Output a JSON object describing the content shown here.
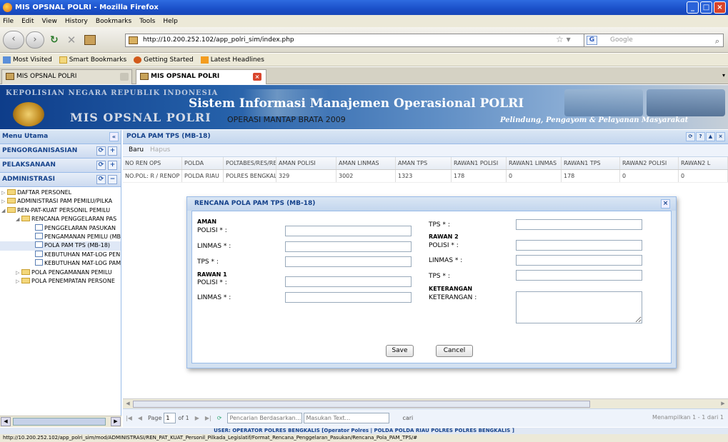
{
  "window": {
    "title": "MIS OPSNAL POLRI - Mozilla Firefox"
  },
  "menu": [
    "File",
    "Edit",
    "View",
    "History",
    "Bookmarks",
    "Tools",
    "Help"
  ],
  "nav": {
    "url": "http://10.200.252.102/app_polri_sim/index.php",
    "search_placeholder": "Google"
  },
  "bookmarks": [
    "Most Visited",
    "Smart Bookmarks",
    "Getting Started",
    "Latest Headlines"
  ],
  "tabs": [
    "MIS OPSNAL POLRI",
    "MIS OPSNAL POLRI"
  ],
  "banner": {
    "org": "KEPOLISIAN NEGARA REPUBLIK INDONESIA",
    "app": "MIS OPSNAL POLRI",
    "system": "Sistem Informasi Manajemen Operasional POLRI",
    "operation": "OPERASI MANTAP BRATA 2009",
    "motto": "Pelindung, Pengayom & Pelayanan Masyarakat"
  },
  "sidebar": {
    "title": "Menu Utama",
    "sections": [
      "PENGORGANISASIAN",
      "PELAKSANAAN",
      "ADMINISTRASI"
    ],
    "tree": [
      {
        "label": "DAFTAR PERSONEL",
        "type": "folder",
        "level": 0
      },
      {
        "label": "ADMINISTRASI PAM PEMILU/PILKA",
        "type": "folder",
        "level": 0
      },
      {
        "label": "REN-PAT-KUAT PERSONIL PEMILU",
        "type": "folder",
        "level": 0
      },
      {
        "label": "RENCANA PENGGELARAN PAS",
        "type": "folder",
        "level": 1
      },
      {
        "label": "PENGGELARAN PASUKAN",
        "type": "leaf",
        "level": 2
      },
      {
        "label": "PENGAMANAN PEMILU (MB",
        "type": "leaf",
        "level": 2
      },
      {
        "label": "POLA PAM TPS (MB-18)",
        "type": "leaf",
        "level": 2
      },
      {
        "label": "KEBUTUHAN MAT-LOG PEN",
        "type": "leaf",
        "level": 2
      },
      {
        "label": "KEBUTUHAN MAT-LOG PAM",
        "type": "leaf",
        "level": 2
      },
      {
        "label": "POLA PENGAMANAN PEMILU",
        "type": "folder",
        "level": 1
      },
      {
        "label": "POLA PENEMPATAN PERSONE",
        "type": "folder",
        "level": 1
      }
    ]
  },
  "main": {
    "title": "POLA PAM TPS (MB-18)",
    "toolbar": {
      "new": "Baru",
      "delete": "Hapus"
    },
    "columns": [
      "NO REN OPS",
      "POLDA",
      "POLTABES/RES/RE",
      "AMAN POLISI",
      "AMAN LINMAS",
      "AMAN TPS",
      "RAWAN1 POLISI",
      "RAWAN1 LINMAS",
      "RAWAN1 TPS",
      "RAWAN2 POLISI",
      "RAWAN2 L"
    ],
    "rows": [
      [
        "NO.POL: R / RENOP",
        "POLDA RIAU",
        "POLRES BENGKALI",
        "329",
        "3002",
        "1323",
        "178",
        "0",
        "178",
        "0",
        "0"
      ]
    ],
    "paging": {
      "page_label": "Page",
      "page": "1",
      "of": "of 1",
      "search_placeholder": "Pencarian Berdasarkan...",
      "text_placeholder": "Masukan Text...",
      "find": "cari",
      "info": "Menampilkan 1 - 1 dari 1"
    }
  },
  "dialog": {
    "title": "RENCANA POLA PAM TPS (MB-18)",
    "aman": "AMAN",
    "rawan1": "RAWAN 1",
    "rawan2": "RAWAN 2",
    "keterangan_head": "KETERANGAN",
    "polisi": "POLISI * :",
    "linmas": "LINMAS * :",
    "tps": "TPS * :",
    "keterangan": "KETERANGAN :",
    "save": "Save",
    "cancel": "Cancel"
  },
  "userbar": "USER: OPERATOR POLRES BENGKALIS [Operator Polres | POLDA POLDA RIAU POLRES POLRES BENGKALIS ]",
  "status": "http://10.200.252.102/app_polri_sim/mod/ADMINISTRASI/REN_PAT_KUAT_Personil_Pilkada_Legislatif/Format_Rencana_Penggelaran_Pasukan/Rencana_Pola_PAM_TPS/#"
}
